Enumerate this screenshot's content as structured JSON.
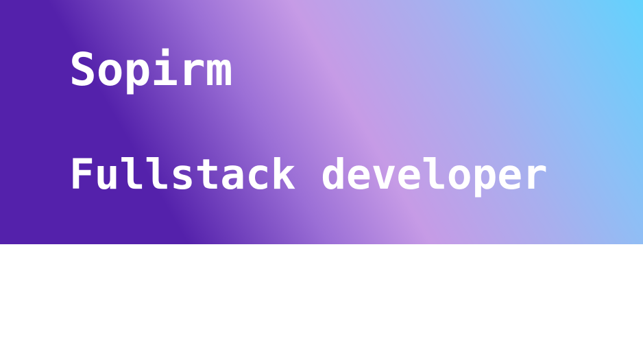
{
  "hero": {
    "name": "Sopirm",
    "role": "Fullstack developer",
    "gradient_colors": [
      "#5421ab",
      "#c69be6",
      "#62d2fd"
    ],
    "text_color": "#ffffff"
  },
  "page": {
    "background": "#ffffff"
  }
}
